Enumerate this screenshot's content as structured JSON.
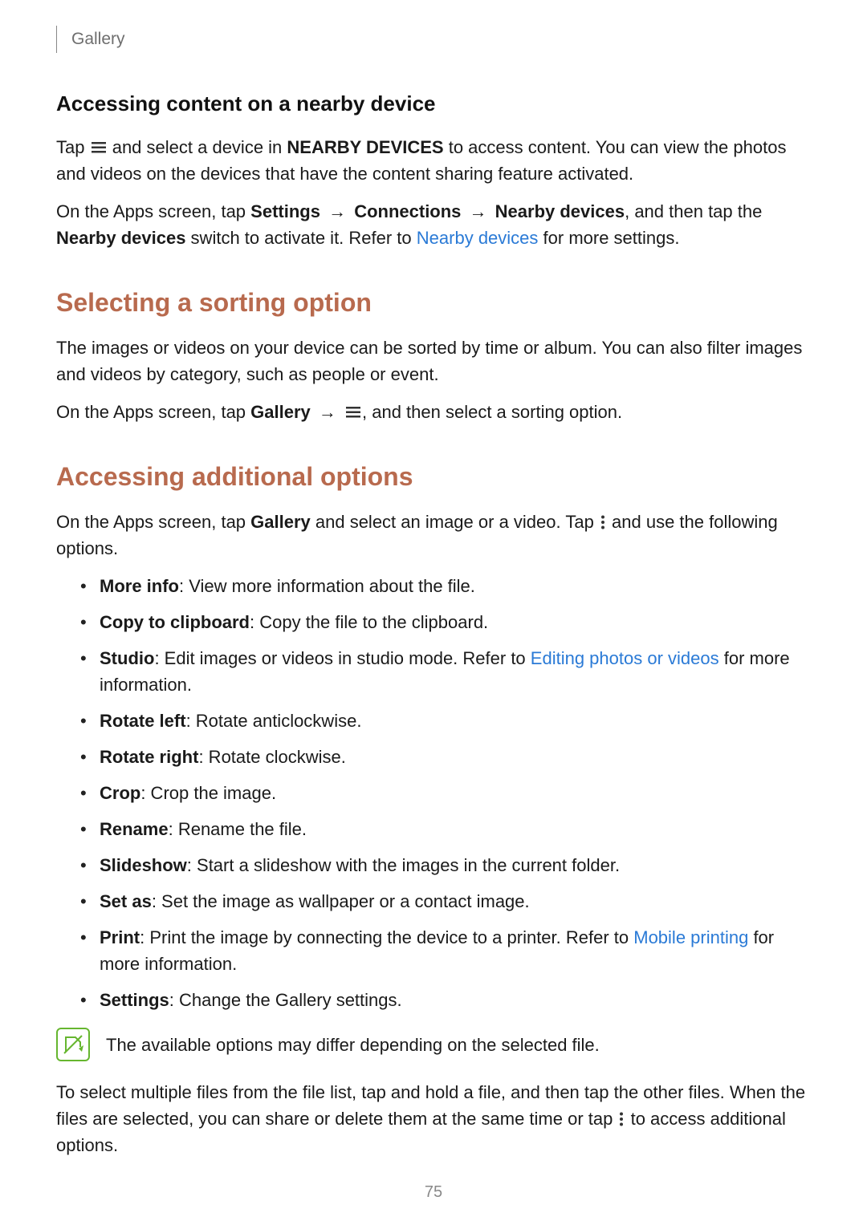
{
  "breadcrumb": "Gallery",
  "section1": {
    "heading": "Accessing content on a nearby device",
    "p1_pre": "Tap ",
    "p1_mid": " and select a device in ",
    "p1_nearby": "NEARBY DEVICES",
    "p1_post": " to access content. You can view the photos and videos on the devices that have the content sharing feature activated.",
    "p2_pre": "On the Apps screen, tap ",
    "p2_settings": "Settings",
    "p2_arrow1": " → ",
    "p2_connections": "Connections",
    "p2_arrow2": " → ",
    "p2_nearby": "Nearby devices",
    "p2_mid": ", and then tap the ",
    "p2_switch": "Nearby devices",
    "p2_post1": " switch to activate it. Refer to ",
    "p2_link": "Nearby devices",
    "p2_post2": " for more settings."
  },
  "section2": {
    "heading": "Selecting a sorting option",
    "p1": "The images or videos on your device can be sorted by time or album. You can also filter images and videos by category, such as people or event.",
    "p2_pre": "On the Apps screen, tap ",
    "p2_gallery": "Gallery",
    "p2_arrow": " → ",
    "p2_post": ", and then select a sorting option."
  },
  "section3": {
    "heading": "Accessing additional options",
    "p1_pre": "On the Apps screen, tap ",
    "p1_gallery": "Gallery",
    "p1_mid": " and select an image or a video. Tap ",
    "p1_post": " and use the following options.",
    "items": {
      "moreinfo_bold": "More info",
      "moreinfo_text": ": View more information about the file.",
      "copy_bold": "Copy to clipboard",
      "copy_text": ": Copy the file to the clipboard.",
      "studio_bold": "Studio",
      "studio_text1": ": Edit images or videos in studio mode. Refer to ",
      "studio_link": "Editing photos or videos",
      "studio_text2": " for more information.",
      "rotleft_bold": "Rotate left",
      "rotleft_text": ": Rotate anticlockwise.",
      "rotright_bold": "Rotate right",
      "rotright_text": ": Rotate clockwise.",
      "crop_bold": "Crop",
      "crop_text": ": Crop the image.",
      "rename_bold": "Rename",
      "rename_text": ": Rename the file.",
      "slideshow_bold": "Slideshow",
      "slideshow_text": ": Start a slideshow with the images in the current folder.",
      "setas_bold": "Set as",
      "setas_text": ": Set the image as wallpaper or a contact image.",
      "print_bold": "Print",
      "print_text1": ": Print the image by connecting the device to a printer. Refer to ",
      "print_link": "Mobile printing",
      "print_text2": " for more information.",
      "settings_bold": "Settings",
      "settings_text": ": Change the Gallery settings."
    },
    "note": "The available options may differ depending on the selected file.",
    "p2_pre": "To select multiple files from the file list, tap and hold a file, and then tap the other files. When the files are selected, you can share or delete them at the same time or tap ",
    "p2_post": " to access additional options."
  },
  "page_number": "75"
}
